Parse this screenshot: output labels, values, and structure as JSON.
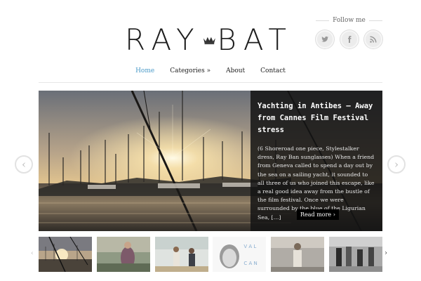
{
  "header": {
    "logo_left": "RAY",
    "logo_right": "BAT",
    "follow_label": "Follow me",
    "social": [
      {
        "icon": "twitter-icon"
      },
      {
        "icon": "facebook-icon"
      },
      {
        "icon": "rss-icon"
      }
    ]
  },
  "nav": {
    "items": [
      {
        "label": "Home",
        "active": true
      },
      {
        "label": "Categories »"
      },
      {
        "label": "About"
      },
      {
        "label": "Contact"
      }
    ]
  },
  "slider": {
    "title": "Yachting in Antibes – Away from Cannes Film Festival stress",
    "excerpt": "(6 Shoreroad one piece, Stylestalker dress, Ray Ban sunglasses) When a friend from Geneva called to spend a day out by the sea on a sailing yacht, it sounded to all three of us who joined this escape, like a real good idea away from the bustle of the film festival. Once we were surrounded by the blue of the Ligurian Sea, […]",
    "read_more": "Read more ›",
    "prev_icon": "‹",
    "next_icon": "›"
  },
  "thumbnails": {
    "prev_icon": "‹",
    "next_icon": "›",
    "thumb3_text": [
      "V A L",
      "C A N"
    ]
  },
  "colors": {
    "accent": "#4a9ac8",
    "caption_bg": "#141414"
  }
}
